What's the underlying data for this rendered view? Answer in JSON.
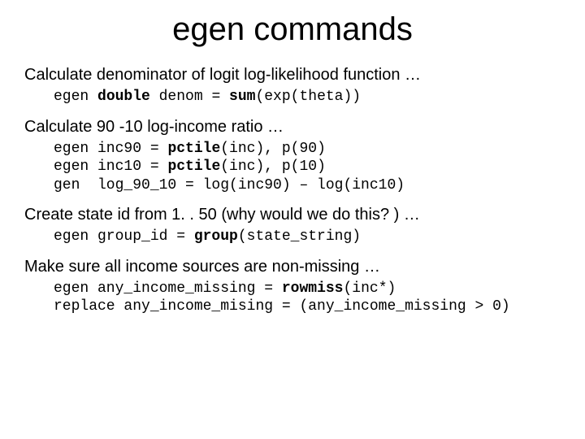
{
  "title": "egen commands",
  "sections": [
    {
      "desc": "Calculate denominator of logit log-likelihood function …",
      "code_html": "egen <span class=\"b\">double</span> denom = <span class=\"b\">sum</span>(exp(theta))"
    },
    {
      "desc": "Calculate 90 -10 log-income ratio …",
      "code_html": "egen inc90 = <span class=\"b\">pctile</span>(inc), p(90)\negen inc10 = <span class=\"b\">pctile</span>(inc), p(10)\ngen  log_90_10 = log(inc90) – log(inc10)"
    },
    {
      "desc": "Create state id from 1. . 50 (why would we do this? ) …",
      "code_html": "egen group_id = <span class=\"b\">group</span>(state_string)"
    },
    {
      "desc": "Make sure all income sources are non-missing …",
      "code_html": "egen any_income_missing = <span class=\"b\">rowmiss</span>(inc*)\nreplace any_income_mising = (any_income_missing > 0)"
    }
  ]
}
